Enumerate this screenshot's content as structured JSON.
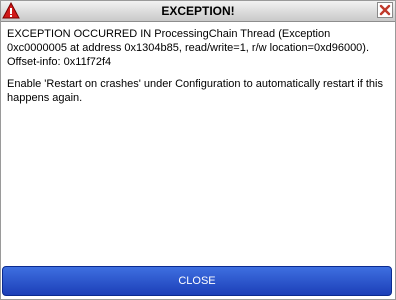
{
  "dialog": {
    "title": "EXCEPTION!",
    "message": "EXCEPTION OCCURRED IN ProcessingChain Thread (Exception 0xc0000005 at address 0x1304b85, read/write=1, r/w location=0xd96000). Offset-info: 0x11f72f4",
    "hint": "Enable 'Restart on crashes' under Configuration to automatically restart if this happens again.",
    "close_label": "CLOSE"
  },
  "icons": {
    "warning": "warning-triangle-icon",
    "close": "close-x-icon"
  },
  "colors": {
    "button_blue": "#2a55d0",
    "warning_red": "#d01818",
    "close_red": "#c0392b"
  }
}
